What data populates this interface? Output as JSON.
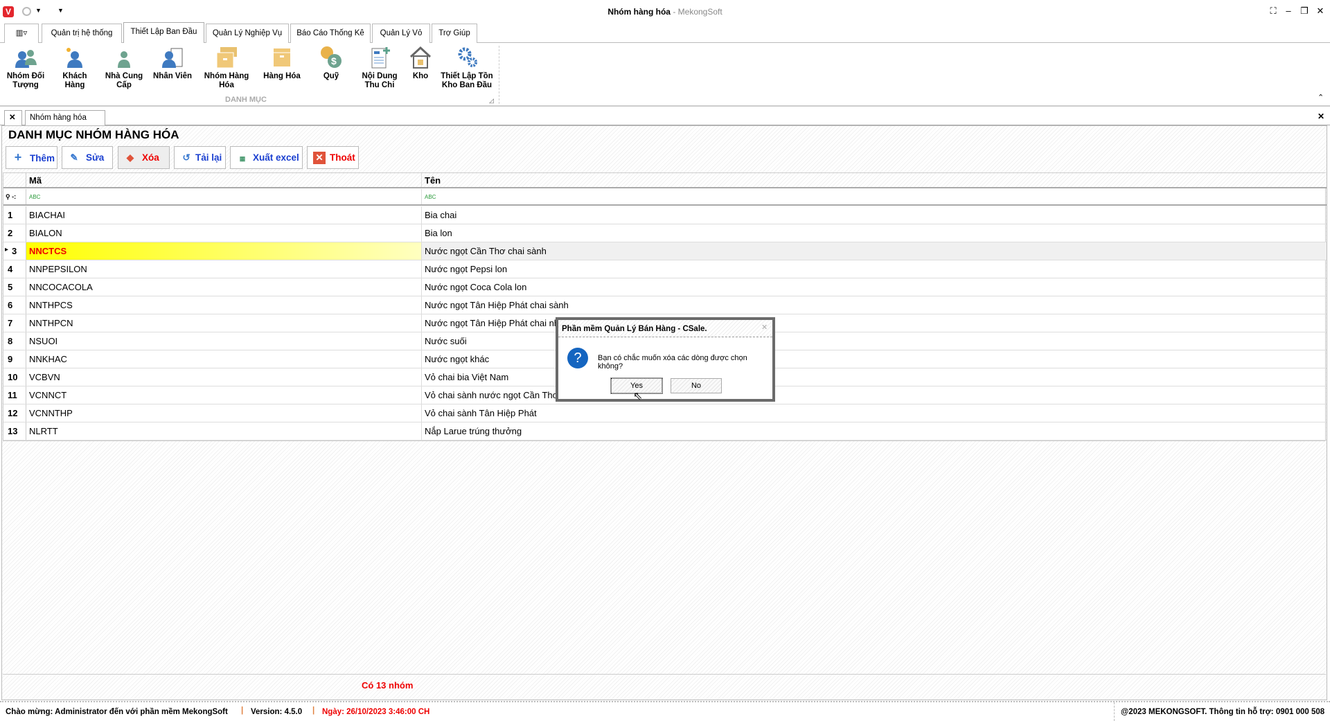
{
  "window": {
    "title": "Nhóm hàng hóa",
    "app": " - MekongSoft"
  },
  "ribbon_tabs": [
    "Quản trị hệ thống",
    "Thiết Lập Ban Đầu",
    "Quản Lý Nghiệp Vụ",
    "Báo Cáo Thống Kê",
    "Quản Lý Vỏ",
    "Trợ Giúp"
  ],
  "ribbon_buttons": [
    {
      "l1": "Nhóm Đối",
      "l2": "Tượng",
      "icon": "people-group-icon"
    },
    {
      "l1": "Khách",
      "l2": "Hàng",
      "icon": "customer-icon"
    },
    {
      "l1": "Nhà Cung",
      "l2": "Cấp",
      "icon": "supplier-icon"
    },
    {
      "l1": "Nhân Viên",
      "l2": "",
      "icon": "employee-icon"
    },
    {
      "l1": "Nhóm Hàng",
      "l2": "Hóa",
      "icon": "boxes-icon"
    },
    {
      "l1": "Hàng Hóa",
      "l2": "",
      "icon": "box-icon"
    },
    {
      "l1": "Quỹ",
      "l2": "",
      "icon": "money-icon"
    },
    {
      "l1": "Nội Dung",
      "l2": "Thu Chi",
      "icon": "document-add-icon"
    },
    {
      "l1": "Kho",
      "l2": "",
      "icon": "warehouse-icon"
    },
    {
      "l1": "Thiết Lập Tồn",
      "l2": "Kho Ban Đầu",
      "icon": "gears-icon"
    }
  ],
  "ribbon_group": "DANH MỤC",
  "doc_tab": "Nhóm hàng hóa",
  "heading": "DANH MỤC NHÓM HÀNG HÓA",
  "toolbar": {
    "add": "Thêm",
    "edit": "Sửa",
    "delete": "Xóa",
    "reload": "Tải lại",
    "export": "Xuất excel",
    "exit": "Thoát"
  },
  "grid": {
    "columns": [
      "Mã",
      "Tên"
    ],
    "rows": [
      [
        "1",
        "BIACHAI",
        "Bia chai"
      ],
      [
        "2",
        "BIALON",
        "Bia lon"
      ],
      [
        "3",
        "NNCTCS",
        "Nước ngọt Cần Thơ chai sành"
      ],
      [
        "4",
        "NNPEPSILON",
        "Nước ngọt Pepsi lon"
      ],
      [
        "5",
        "NNCOCACOLA",
        "Nước ngọt Coca Cola lon"
      ],
      [
        "6",
        "NNTHPCS",
        "Nước ngọt Tân Hiệp Phát chai sành"
      ],
      [
        "7",
        "NNTHPCN",
        "Nước ngọt Tân Hiệp Phát chai nhựa"
      ],
      [
        "8",
        "NSUOI",
        "Nước suối"
      ],
      [
        "9",
        "NNKHAC",
        "Nước ngọt khác"
      ],
      [
        "10",
        "VCBVN",
        "Vỏ chai bia Việt Nam"
      ],
      [
        "11",
        "VCNNCT",
        "Vỏ chai sành nước ngọt Cần Thơ"
      ],
      [
        "12",
        "VCNNTHP",
        "Vỏ chai sành Tân Hiệp Phát"
      ],
      [
        "13",
        "NLRTT",
        "Nắp Larue trúng thưởng"
      ]
    ],
    "selected_row": 3
  },
  "footer_count": "Có 13 nhóm",
  "status": {
    "welcome": "Chào mừng: Administrator đến với phần mềm MekongSoft",
    "version": "Version: 4.5.0",
    "date": "Ngày: 26/10/2023 3:46:00 CH",
    "copyright": "@2023 MEKONGSOFT. Thông tin hỗ trợ: 0901 000 508"
  },
  "dialog": {
    "title": "Phần mềm Quản Lý Bán Hàng - CSale.",
    "message": "Bạn có chắc muốn xóa các dòng được chọn không?",
    "yes": "Yes",
    "no": "No"
  }
}
